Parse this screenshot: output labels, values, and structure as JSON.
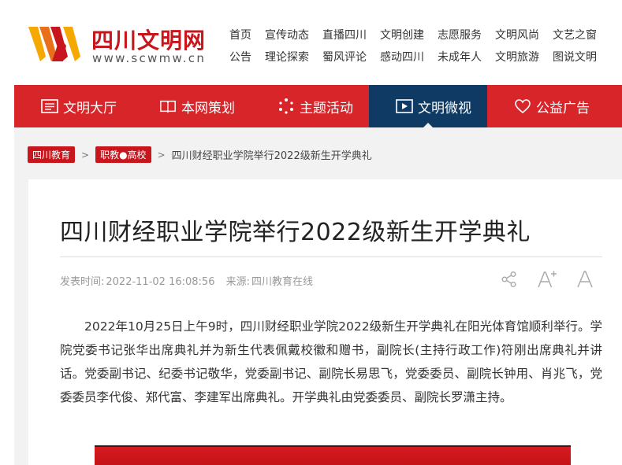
{
  "header": {
    "site_name": "四川文明网",
    "site_url": "www.scwmw.cn",
    "nav_row1": [
      "首页",
      "宣传动态",
      "直播四川",
      "文明创建",
      "志愿服务",
      "文明风尚",
      "文艺之窗"
    ],
    "nav_row2": [
      "公告",
      "理论探索",
      "蜀风评论",
      "感动四川",
      "未成年人",
      "文明旅游",
      "图说文明"
    ]
  },
  "main_nav": [
    {
      "label": "文明大厅",
      "icon": "hall-icon"
    },
    {
      "label": "本网策划",
      "icon": "book-icon"
    },
    {
      "label": "主题活动",
      "icon": "sparkle-icon"
    },
    {
      "label": "文明微视",
      "icon": "video-play-icon",
      "active": true
    },
    {
      "label": "公益广告",
      "icon": "heart-hands-icon"
    }
  ],
  "breadcrumb": {
    "item1": "四川教育",
    "item2": "职教●高校",
    "current": "四川财经职业学院举行2022级新生开学典礼",
    "separator": ">"
  },
  "article": {
    "title": "四川财经职业学院举行2022级新生开学典礼",
    "publish_label": "发表时间:",
    "publish_time": "2022-11-02 16:08:56",
    "source_label": "来源:",
    "source": "四川教育在线",
    "body": "2022年10月25日上午9时，四川财经职业学院2022级新生开学典礼在阳光体育馆顺利举行。学院党委书记张华出席典礼并为新生代表佩戴校徽和赠书，副院长(主持行政工作)符刚出席典礼并讲话。党委副书记、纪委书记敬华，党委副书记、副院长易思飞，党委委员、副院长钟用、肖兆飞，党委委员李代俊、郑代富、李建军出席典礼。开学典礼由党委委员、副院长罗潇主持。"
  },
  "colors": {
    "brand_red": "#d7252a",
    "nav_active": "#0f3a64",
    "logo_yellow": "#f5a800"
  }
}
